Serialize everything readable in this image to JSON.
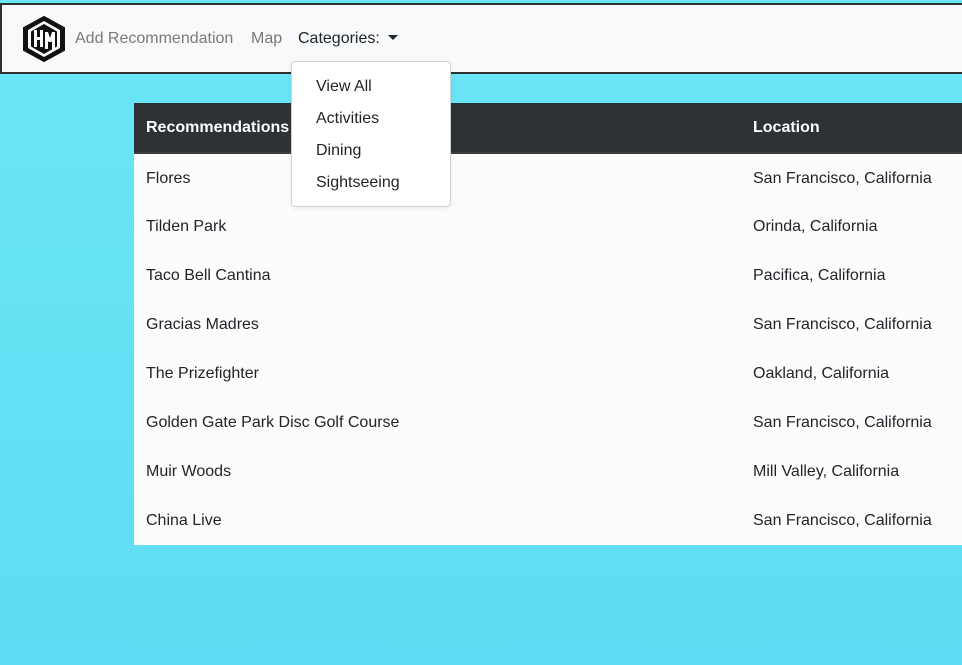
{
  "navbar": {
    "logo_text": "HM",
    "links": [
      {
        "label": "Add Recommendation"
      },
      {
        "label": "Map"
      }
    ],
    "categories_label": "Categories:"
  },
  "dropdown": {
    "items": [
      {
        "label": "View All"
      },
      {
        "label": "Activities"
      },
      {
        "label": "Dining"
      },
      {
        "label": "Sightseeing"
      }
    ]
  },
  "table": {
    "headers": [
      "Recommendations",
      "Location"
    ],
    "rows": [
      {
        "name": "Flores",
        "location": "San Francisco, California"
      },
      {
        "name": "Tilden Park",
        "location": "Orinda, California"
      },
      {
        "name": "Taco Bell Cantina",
        "location": "Pacifica, California"
      },
      {
        "name": "Gracias Madres",
        "location": "San Francisco, California"
      },
      {
        "name": "The Prizefighter",
        "location": "Oakland, California"
      },
      {
        "name": "Golden Gate Park Disc Golf Course",
        "location": "San Francisco, California"
      },
      {
        "name": "Muir Woods",
        "location": "Mill Valley, California"
      },
      {
        "name": "China Live",
        "location": "San Francisco, California"
      }
    ]
  },
  "colors": {
    "background": "#62dff4",
    "navbar": "#f8f9fa",
    "table_header": "#2e3237"
  }
}
